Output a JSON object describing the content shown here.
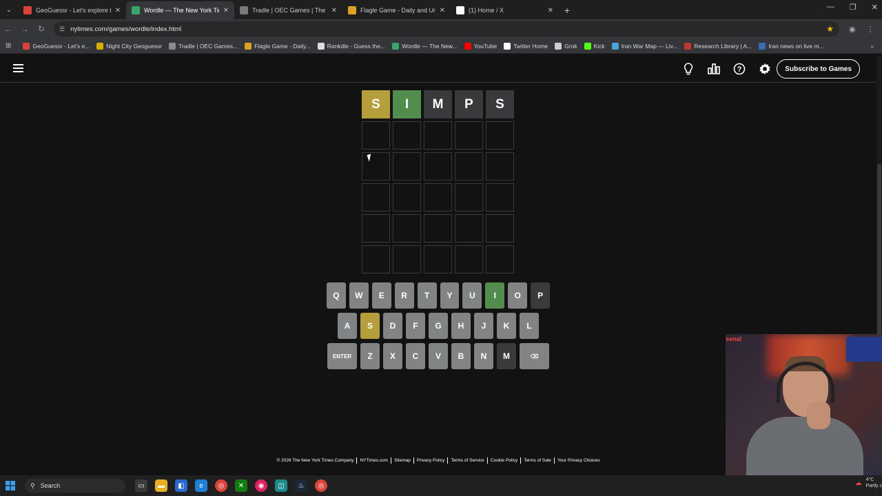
{
  "browser": {
    "tabs": [
      {
        "label": "GeoGuessr - Let's explore the w",
        "color": "#d9443a",
        "active": false
      },
      {
        "label": "Wordle — The New York Times",
        "color": "#3aa56b",
        "active": true
      },
      {
        "label": "Tradle | OEC Games | The Obse",
        "color": "#7a7a7a",
        "active": false
      },
      {
        "label": "Flagle Game - Daily and Unlim",
        "color": "#e0a020",
        "active": false
      },
      {
        "label": "(1) Home / X",
        "color": "#ffffff",
        "active": false
      }
    ],
    "new_tab": "+",
    "url": "nytimes.com/games/wordle/index.html",
    "bookmarks": [
      {
        "label": "GeoGuessr - Let's e...",
        "color": "#d9443a"
      },
      {
        "label": "Night City Geoguessr",
        "color": "#d8b000"
      },
      {
        "label": "Tradle | OEC Games...",
        "color": "#8a8a8a"
      },
      {
        "label": "Flagle Game - Daily...",
        "color": "#e0a020"
      },
      {
        "label": "Rankdle - Guess the...",
        "color": "#dddddd"
      },
      {
        "label": "Wordle — The New...",
        "color": "#3aa56b"
      },
      {
        "label": "YouTube",
        "color": "#ff0000"
      },
      {
        "label": "Twitter Home",
        "color": "#ffffff"
      },
      {
        "label": "Grok",
        "color": "#cccccc"
      },
      {
        "label": "Kick",
        "color": "#53fc18"
      },
      {
        "label": "Iran War Map — Liv...",
        "color": "#4aa3df"
      },
      {
        "label": "Research Library | A...",
        "color": "#c0392b"
      },
      {
        "label": "Iran news on live m...",
        "color": "#3b6bb5"
      }
    ]
  },
  "header": {
    "subscribe_label": "Subscribe to Games"
  },
  "board": {
    "rows": [
      [
        {
          "letter": "S",
          "state": "present"
        },
        {
          "letter": "I",
          "state": "correct"
        },
        {
          "letter": "M",
          "state": "absent"
        },
        {
          "letter": "P",
          "state": "absent"
        },
        {
          "letter": "S",
          "state": "absent"
        }
      ],
      [
        {
          "letter": "",
          "state": "empty"
        },
        {
          "letter": "",
          "state": "empty"
        },
        {
          "letter": "",
          "state": "empty"
        },
        {
          "letter": "",
          "state": "empty"
        },
        {
          "letter": "",
          "state": "empty"
        }
      ],
      [
        {
          "letter": "",
          "state": "empty"
        },
        {
          "letter": "",
          "state": "empty"
        },
        {
          "letter": "",
          "state": "empty"
        },
        {
          "letter": "",
          "state": "empty"
        },
        {
          "letter": "",
          "state": "empty"
        }
      ],
      [
        {
          "letter": "",
          "state": "empty"
        },
        {
          "letter": "",
          "state": "empty"
        },
        {
          "letter": "",
          "state": "empty"
        },
        {
          "letter": "",
          "state": "empty"
        },
        {
          "letter": "",
          "state": "empty"
        }
      ],
      [
        {
          "letter": "",
          "state": "empty"
        },
        {
          "letter": "",
          "state": "empty"
        },
        {
          "letter": "",
          "state": "empty"
        },
        {
          "letter": "",
          "state": "empty"
        },
        {
          "letter": "",
          "state": "empty"
        }
      ],
      [
        {
          "letter": "",
          "state": "empty"
        },
        {
          "letter": "",
          "state": "empty"
        },
        {
          "letter": "",
          "state": "empty"
        },
        {
          "letter": "",
          "state": "empty"
        },
        {
          "letter": "",
          "state": "empty"
        }
      ]
    ]
  },
  "keyboard": {
    "rows": [
      [
        {
          "k": "Q"
        },
        {
          "k": "W"
        },
        {
          "k": "E"
        },
        {
          "k": "R"
        },
        {
          "k": "T"
        },
        {
          "k": "Y"
        },
        {
          "k": "U"
        },
        {
          "k": "I",
          "state": "correct"
        },
        {
          "k": "O"
        },
        {
          "k": "P",
          "state": "absent"
        }
      ],
      [
        {
          "k": "A"
        },
        {
          "k": "S",
          "state": "present"
        },
        {
          "k": "D"
        },
        {
          "k": "F"
        },
        {
          "k": "G"
        },
        {
          "k": "H"
        },
        {
          "k": "J"
        },
        {
          "k": "K"
        },
        {
          "k": "L"
        }
      ],
      [
        {
          "k": "ENTER",
          "wide": true
        },
        {
          "k": "Z"
        },
        {
          "k": "X"
        },
        {
          "k": "C"
        },
        {
          "k": "V"
        },
        {
          "k": "B"
        },
        {
          "k": "N"
        },
        {
          "k": "M",
          "state": "absent"
        },
        {
          "k": "⌫",
          "wide": true
        }
      ]
    ]
  },
  "footer": {
    "links": [
      "© 2026 The New York Times Company",
      "NYTimes.com",
      "Sitemap",
      "Privacy Policy",
      "Terms of Service",
      "Cookie Policy",
      "Terms of Sale",
      "Your Privacy Choices"
    ]
  },
  "taskbar": {
    "search_placeholder": "Search",
    "weather_temp": "4°C",
    "weather_desc": "Partly c"
  },
  "webcam": {
    "sign_text": "senal"
  }
}
